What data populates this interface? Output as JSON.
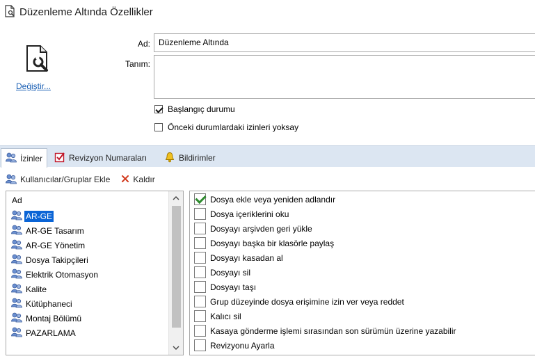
{
  "window": {
    "title": "Düzenleme Altında Özellikler"
  },
  "change_link": "Değiştir...",
  "form": {
    "name_label": "Ad:",
    "name_value": "Düzenleme Altında",
    "description_label": "Tanım:",
    "description_value": "",
    "start_state": {
      "label": "Başlangıç durumu",
      "checked": true
    },
    "ignore_previous": {
      "label": "Önceki durumlardaki izinleri yoksay",
      "checked": false
    }
  },
  "tabs": [
    {
      "label": "İzinler",
      "icon": "users-icon",
      "active": true
    },
    {
      "label": "Revizyon Numaraları",
      "icon": "checkbox-red-icon",
      "active": false
    },
    {
      "label": "Bildirimler",
      "icon": "bell-icon",
      "active": false
    }
  ],
  "toolbar": {
    "add_label": "Kullanıcılar/Gruplar Ekle",
    "remove_label": "Kaldır"
  },
  "user_list": {
    "header": "Ad",
    "items": [
      {
        "label": "AR-GE",
        "selected": true
      },
      {
        "label": "AR-GE Tasarım",
        "selected": false
      },
      {
        "label": "AR-GE Yönetim",
        "selected": false
      },
      {
        "label": "Dosya Takipçileri",
        "selected": false
      },
      {
        "label": "Elektrik Otomasyon",
        "selected": false
      },
      {
        "label": "Kalite",
        "selected": false
      },
      {
        "label": "Kütüphaneci",
        "selected": false
      },
      {
        "label": "Montaj Bölümü",
        "selected": false
      },
      {
        "label": "PAZARLAMA",
        "selected": false
      }
    ]
  },
  "permissions": [
    {
      "label": "Dosya ekle veya yeniden adlandır",
      "checked": true
    },
    {
      "label": "Dosya içeriklerini oku",
      "checked": false
    },
    {
      "label": "Dosyayı arşivden geri yükle",
      "checked": false
    },
    {
      "label": "Dosyayı başka bir klasörle paylaş",
      "checked": false
    },
    {
      "label": "Dosyayı kasadan al",
      "checked": false
    },
    {
      "label": "Dosyayı sil",
      "checked": false
    },
    {
      "label": "Dosyayı taşı",
      "checked": false
    },
    {
      "label": "Grup düzeyinde dosya erişimine izin ver veya reddet",
      "checked": false
    },
    {
      "label": "Kalıcı sil",
      "checked": false
    },
    {
      "label": "Kasaya gönderme işlemi sırasından son sürümün üzerine yazabilir",
      "checked": false
    },
    {
      "label": "Revizyonu Ayarla",
      "checked": false
    }
  ]
}
